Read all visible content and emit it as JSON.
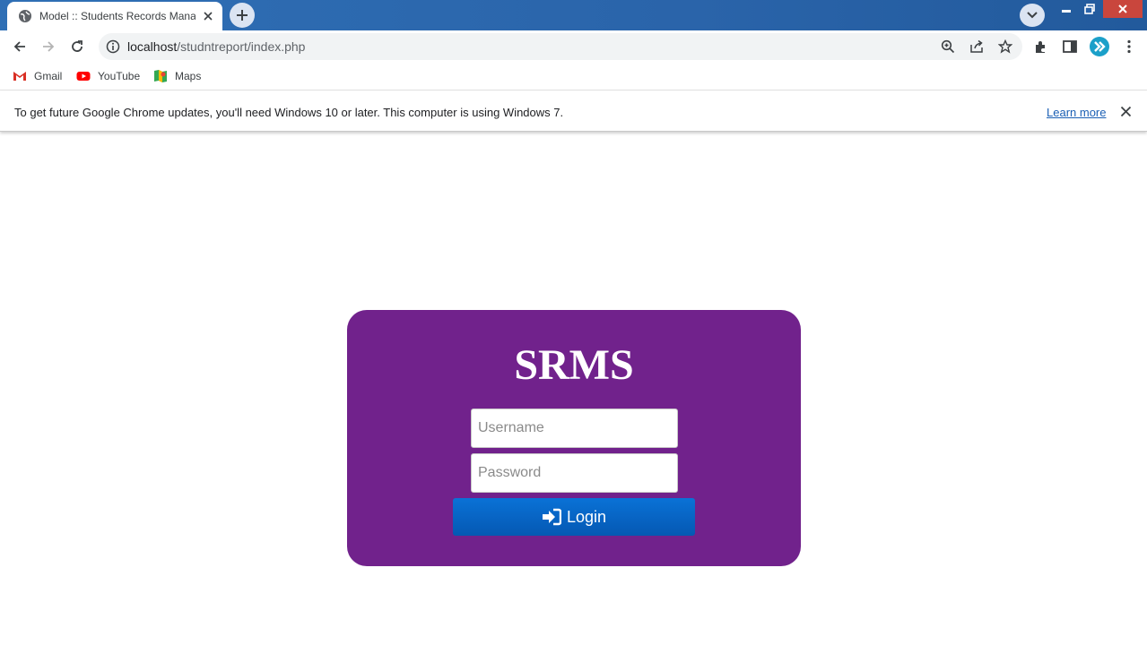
{
  "browser": {
    "tab_title": "Model :: Students Records Manag",
    "url_host": "localhost",
    "url_path": "/studntreport/index.php",
    "bookmarks": [
      {
        "label": "Gmail",
        "icon": "gmail-icon"
      },
      {
        "label": "YouTube",
        "icon": "youtube-icon"
      },
      {
        "label": "Maps",
        "icon": "maps-icon"
      }
    ],
    "infobar": {
      "message": "To get future Google Chrome updates, you'll need Windows 10 or later. This computer is using Windows 7.",
      "link": "Learn more"
    }
  },
  "login": {
    "brand": "SRMS",
    "username_placeholder": "Username",
    "password_placeholder": "Password",
    "button_label": "Login",
    "colors": {
      "card": "#71228c",
      "button": "#0a72d6"
    }
  }
}
